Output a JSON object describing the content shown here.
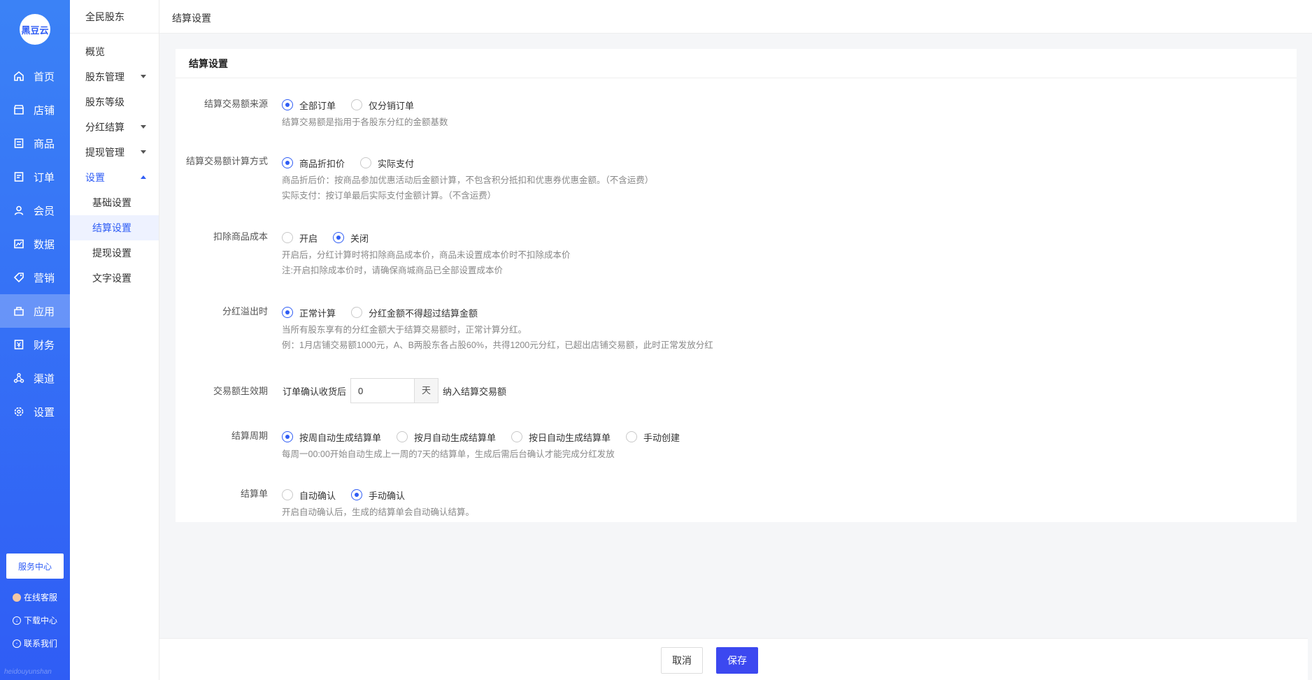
{
  "brand": {
    "logo_text": "黑豆云",
    "footer_mark": "heidouyunshan"
  },
  "nav1": {
    "items": [
      {
        "label": "首页",
        "icon": "home-icon"
      },
      {
        "label": "店铺",
        "icon": "shop-icon"
      },
      {
        "label": "商品",
        "icon": "goods-icon"
      },
      {
        "label": "订单",
        "icon": "order-icon"
      },
      {
        "label": "会员",
        "icon": "user-icon"
      },
      {
        "label": "数据",
        "icon": "chart-icon"
      },
      {
        "label": "营销",
        "icon": "tag-icon"
      },
      {
        "label": "应用",
        "icon": "app-icon"
      },
      {
        "label": "财务",
        "icon": "finance-icon"
      },
      {
        "label": "渠道",
        "icon": "channel-icon"
      },
      {
        "label": "设置",
        "icon": "gear-icon"
      }
    ],
    "active": "应用",
    "service_center": "服务中心",
    "links": [
      "在线客服",
      "下载中心",
      "联系我们"
    ]
  },
  "nav2": {
    "title": "全民股东",
    "items": [
      "概览",
      "股东管理",
      "股东等级",
      "分红结算",
      "提现管理",
      "设置"
    ],
    "sub_items": [
      "基础设置",
      "结算设置",
      "提现设置",
      "文字设置"
    ],
    "active_sub": "结算设置"
  },
  "header": {
    "breadcrumb": "结算设置"
  },
  "card": {
    "title": "结算设置",
    "rows": {
      "source": {
        "label": "结算交易额来源",
        "options": [
          "全部订单",
          "仅分销订单"
        ],
        "selected": "全部订单",
        "hints": [
          "结算交易额是指用于各股东分红的金额基数"
        ]
      },
      "calc": {
        "label": "结算交易额计算方式",
        "options": [
          "商品折扣价",
          "实际支付"
        ],
        "selected": "商品折扣价",
        "hints": [
          "商品折后价：按商品参加优惠活动后金额计算，不包含积分抵扣和优惠券优惠金额。（不含运费）",
          "实际支付：按订单最后实际支付金额计算。（不含运费）"
        ]
      },
      "cost": {
        "label": "扣除商品成本",
        "options": [
          "开启",
          "关闭"
        ],
        "selected": "关闭",
        "hints": [
          "开启后，分红计算时将扣除商品成本价，商品未设置成本价时不扣除成本价",
          "注:开启扣除成本价时，请确保商城商品已全部设置成本价"
        ]
      },
      "overflow": {
        "label": "分红溢出时",
        "options": [
          "正常计算",
          "分红金额不得超过结算金额"
        ],
        "selected": "正常计算",
        "hints": [
          "当所有股东享有的分红金额大于结算交易额时，正常计算分红。",
          "例：1月店铺交易额1000元，A、B两股东各占股60%，共得1200元分红，已超出店铺交易额，此时正常发放分红"
        ]
      },
      "effective": {
        "label": "交易额生效期",
        "prefix": "订单确认收货后",
        "value": "0",
        "unit": "天",
        "suffix": "纳入结算交易额"
      },
      "period": {
        "label": "结算周期",
        "options": [
          "按周自动生成结算单",
          "按月自动生成结算单",
          "按日自动生成结算单",
          "手动创建"
        ],
        "selected": "按周自动生成结算单",
        "hints": [
          "每周一00:00开始自动生成上一周的7天的结算单，生成后需后台确认才能完成分红发放"
        ]
      },
      "confirm": {
        "label": "结算单",
        "options": [
          "自动确认",
          "手动确认"
        ],
        "selected": "手动确认",
        "hints": [
          "开启自动确认后，生成的结算单会自动确认结算。"
        ]
      }
    }
  },
  "footer": {
    "cancel": "取消",
    "save": "保存"
  },
  "colors": {
    "primary": "#2f5df5",
    "save_button": "#3c48f0"
  }
}
